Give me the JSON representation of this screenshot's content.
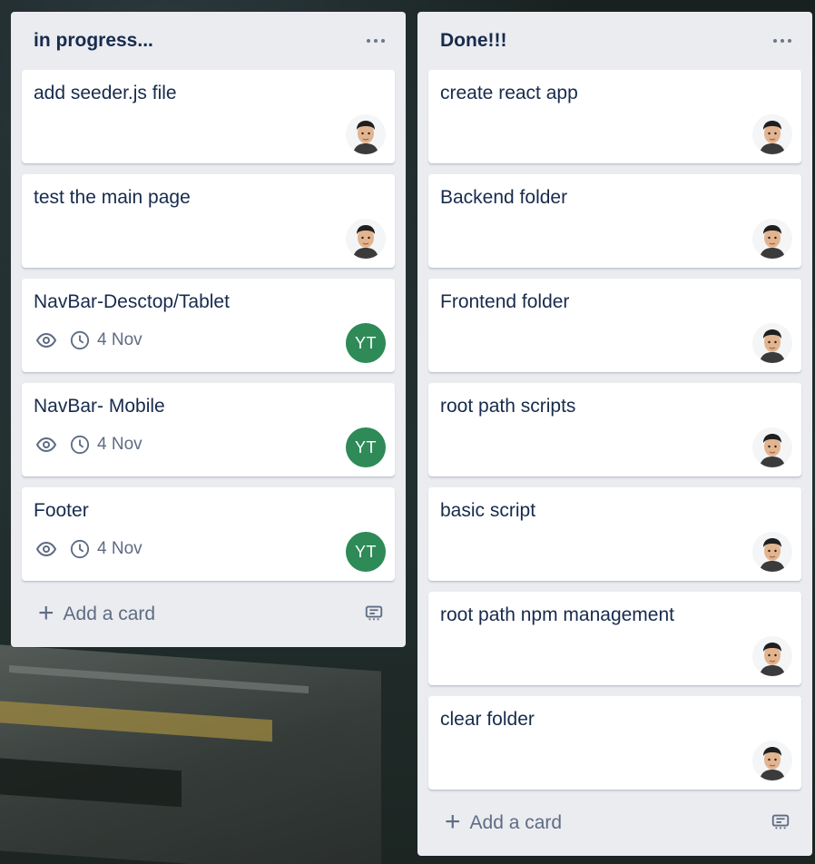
{
  "lists": [
    {
      "title": "in progress...",
      "add_card_label": "Add a card",
      "cards": [
        {
          "title": "add seeder.js file",
          "member": {
            "type": "photo"
          }
        },
        {
          "title": "test the main page",
          "member": {
            "type": "photo"
          }
        },
        {
          "title": "NavBar-Desctop/Tablet",
          "watch": true,
          "due": "4 Nov",
          "member": {
            "type": "initials",
            "initials": "YT",
            "color": "#2e8a57"
          }
        },
        {
          "title": "NavBar- Mobile",
          "watch": true,
          "due": "4 Nov",
          "member": {
            "type": "initials",
            "initials": "YT",
            "color": "#2e8a57"
          }
        },
        {
          "title": "Footer",
          "watch": true,
          "due": "4 Nov",
          "member": {
            "type": "initials",
            "initials": "YT",
            "color": "#2e8a57"
          }
        }
      ]
    },
    {
      "title": "Done!!!",
      "add_card_label": "Add a card",
      "cards": [
        {
          "title": "create react app",
          "member": {
            "type": "photo"
          }
        },
        {
          "title": "Backend folder",
          "member": {
            "type": "photo"
          }
        },
        {
          "title": "Frontend folder",
          "member": {
            "type": "photo"
          }
        },
        {
          "title": "root path scripts",
          "member": {
            "type": "photo"
          }
        },
        {
          "title": "basic script",
          "member": {
            "type": "photo"
          }
        },
        {
          "title": "root path npm management",
          "member": {
            "type": "photo"
          }
        },
        {
          "title": "clear folder",
          "member": {
            "type": "photo"
          }
        }
      ]
    }
  ],
  "icons": {
    "list_menu": "ellipsis-icon",
    "watch": "eye-icon",
    "due": "clock-icon",
    "add": "plus-icon",
    "template": "card-template-icon"
  },
  "colors": {
    "list_bg": "#ebecf0",
    "card_bg": "#ffffff",
    "text": "#172b4d",
    "muted": "#5e6c84",
    "avatar_green": "#2e8a57"
  }
}
